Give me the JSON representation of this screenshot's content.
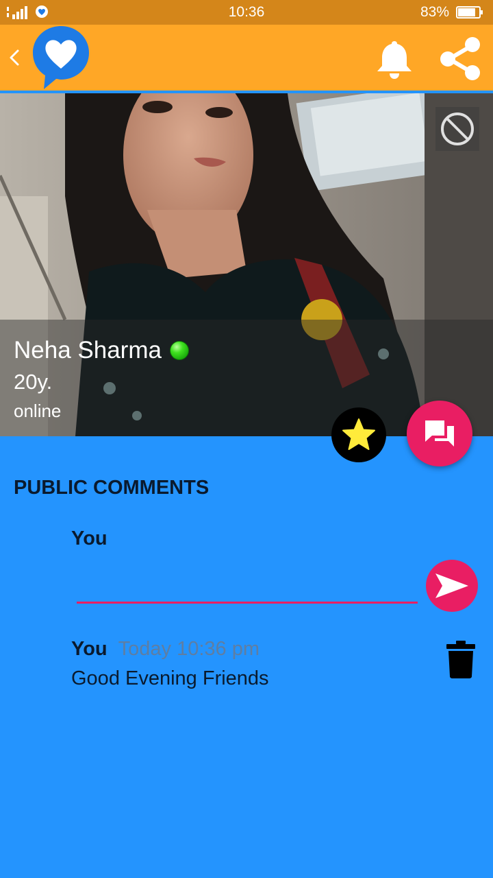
{
  "status_bar": {
    "time": "10:36",
    "battery": "83%",
    "battery_level": 0.83,
    "icons": [
      "dual-sim-icon",
      "signal-icon",
      "app-notification-icon",
      "battery-icon"
    ]
  },
  "app_bar": {
    "icons": [
      "back-icon",
      "app-logo-heart-chat-icon",
      "bell-icon",
      "share-icon"
    ]
  },
  "profile": {
    "name": "Neha Sharma",
    "age": "20y.",
    "status": "online",
    "online_indicator_color": "#2ECC1A"
  },
  "comments_section": {
    "title": "PUBLIC COMMENTS",
    "composer_author": "You",
    "input_value": "",
    "input_placeholder": "",
    "comments": [
      {
        "author": "You",
        "time": "Today 10:36 pm",
        "text": "Good Evening Friends"
      }
    ]
  },
  "colors": {
    "status_bar": "#D4861A",
    "app_bar": "#FFA726",
    "background": "#2494FE",
    "accent": "#E91E63",
    "star": "#FFEB3B"
  }
}
